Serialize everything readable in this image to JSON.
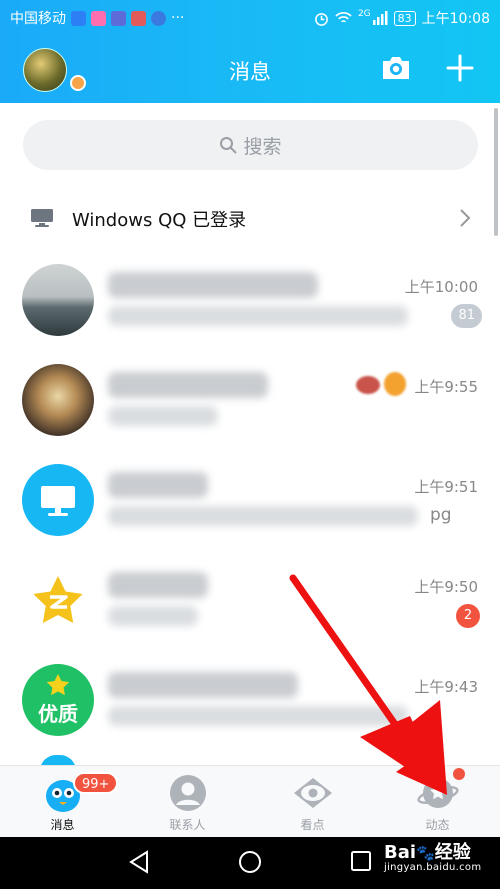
{
  "status_bar": {
    "carrier": "中国移动",
    "more": "···",
    "network": "2G",
    "battery": "83",
    "time": "上午10:08"
  },
  "header": {
    "title": "消息",
    "camera_icon": "camera-icon",
    "add_icon": "plus-icon"
  },
  "search": {
    "placeholder": "搜索",
    "icon": "search-icon"
  },
  "login_notice": {
    "text": "Windows QQ 已登录",
    "icon": "monitor-icon"
  },
  "conversations": [
    {
      "time": "上午10:00",
      "badge": "81",
      "badge_color": "#c4cbd3",
      "avatar": "photo-harbor"
    },
    {
      "time": "上午9:55",
      "badge": "",
      "badge_color": "",
      "avatar": "photo-carousel"
    },
    {
      "time": "上午9:51",
      "badge": "",
      "badge_color": "",
      "avatar": "my-computer-icon",
      "preview_tail": "pg"
    },
    {
      "time": "上午9:50",
      "badge": "2",
      "badge_color": "#f2533f",
      "avatar": "qzone-star-icon"
    },
    {
      "time": "上午9:43",
      "badge": "",
      "badge_color": "",
      "avatar": "premium-badge",
      "avatar_text": "优质"
    }
  ],
  "tabs": [
    {
      "label": "消息",
      "active": true,
      "badge": "99+"
    },
    {
      "label": "联系人",
      "active": false
    },
    {
      "label": "看点",
      "active": false
    },
    {
      "label": "动态",
      "active": false
    }
  ],
  "watermark": {
    "brand": "Bai",
    "brand2": "经验",
    "url": "jingyan.baidu.com"
  },
  "colors": {
    "header_gradient_start": "#1aaaf8",
    "header_gradient_end": "#12c6f3",
    "badge_red": "#f2533f",
    "annotation_arrow": "#ee1111"
  }
}
